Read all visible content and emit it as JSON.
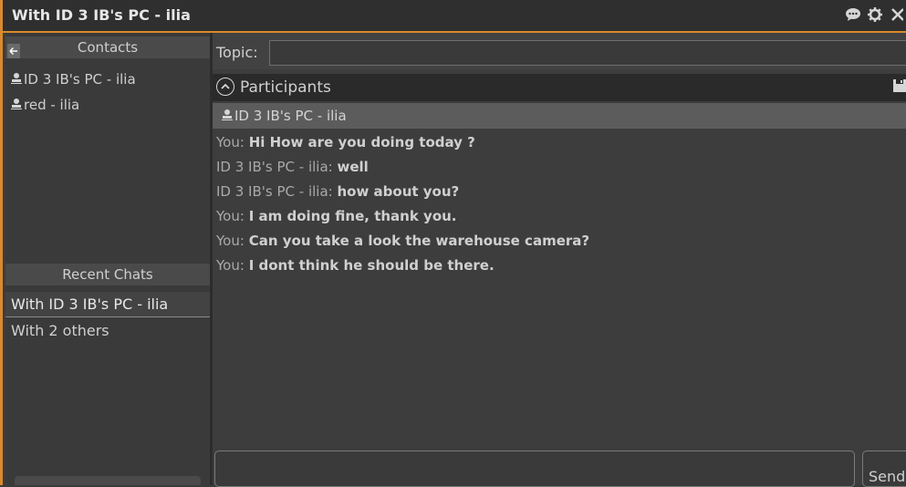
{
  "window": {
    "title": "With ID 3 IB's PC - ilia",
    "accent_color": "#d98a2b",
    "icons": [
      "chat-icon",
      "gear-icon",
      "close-icon"
    ]
  },
  "contacts": {
    "header": "Contacts",
    "items": [
      {
        "name": "ID 3 IB's PC - ilia",
        "icon": "user-icon"
      },
      {
        "name": "red - ilia",
        "icon": "user-icon"
      }
    ]
  },
  "recent_chats": {
    "header": "Recent Chats",
    "items": [
      {
        "label": "With ID 3 IB's PC - ilia",
        "selected": true
      },
      {
        "label": "With 2 others",
        "selected": false
      }
    ]
  },
  "chat": {
    "topic_label": "Topic:",
    "topic_value": "",
    "participants_label": "Participants",
    "participants": [
      "ID 3 IB's PC - ilia"
    ],
    "messages": [
      {
        "sender": "You:",
        "text": "Hi How are you doing today ?"
      },
      {
        "sender": "ID 3 IB's PC - ilia:",
        "text": "well"
      },
      {
        "sender": "ID 3 IB's PC - ilia:",
        "text": "how about you?"
      },
      {
        "sender": "You:",
        "text": "I am doing fine, thank you."
      },
      {
        "sender": "You:",
        "text": "Can you take a look the warehouse camera?"
      },
      {
        "sender": "You:",
        "text": "I dont think he should be there."
      }
    ],
    "compose_value": "",
    "send_label": "Send"
  }
}
